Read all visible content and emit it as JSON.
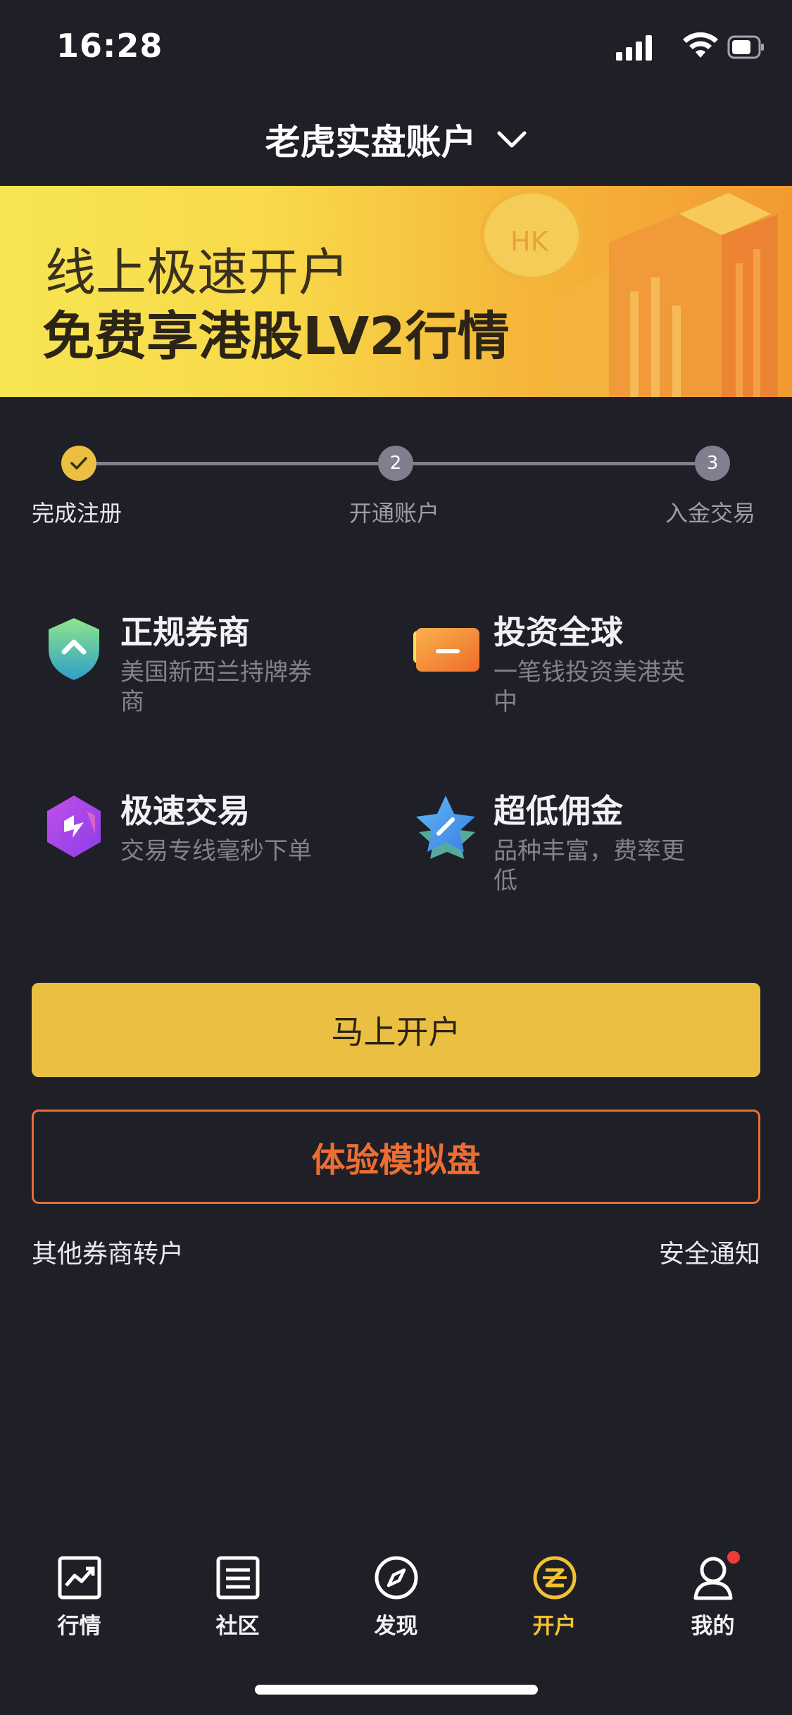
{
  "status_bar": {
    "time": "16:28"
  },
  "header": {
    "title": "老虎实盘账户"
  },
  "banner": {
    "line1": "线上极速开户",
    "line2": "免费享港股LV2行情",
    "art_text": "HK"
  },
  "steps": [
    {
      "label": "完成注册",
      "number": "",
      "done": true
    },
    {
      "label": "开通账户",
      "number": "2",
      "done": false
    },
    {
      "label": "入金交易",
      "number": "3",
      "done": false
    }
  ],
  "features": [
    {
      "title": "正规券商",
      "desc": "美国新西兰持牌券商",
      "icon": "shield-icon"
    },
    {
      "title": "投资全球",
      "desc": "一笔钱投资美港英中",
      "icon": "card-icon"
    },
    {
      "title": "极速交易",
      "desc": "交易专线毫秒下单",
      "icon": "lightning-icon"
    },
    {
      "title": "超低佣金",
      "desc": "品种丰富，费率更低",
      "icon": "star-icon"
    }
  ],
  "buttons": {
    "open_account": "马上开户",
    "demo": "体验模拟盘"
  },
  "links": {
    "transfer": "其他券商转户",
    "security": "安全通知"
  },
  "tabs": [
    {
      "label": "行情",
      "icon": "chart-icon",
      "active": false
    },
    {
      "label": "社区",
      "icon": "document-icon",
      "active": false
    },
    {
      "label": "发现",
      "icon": "compass-icon",
      "active": false
    },
    {
      "label": "开户",
      "icon": "open-account-icon",
      "active": true
    },
    {
      "label": "我的",
      "icon": "profile-icon",
      "active": false
    }
  ],
  "colors": {
    "background": "#1f1f27",
    "accent": "#ebc042",
    "demo": "#ec6e33",
    "inactive": "#7f7f8f"
  }
}
